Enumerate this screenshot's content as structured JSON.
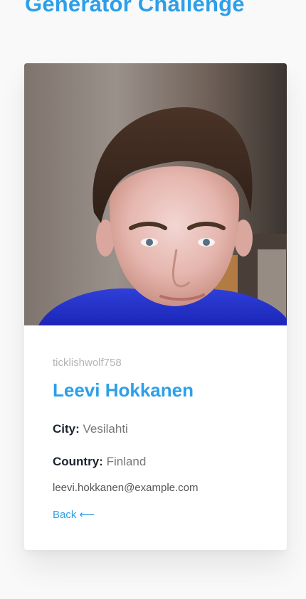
{
  "page": {
    "heading": "Generator Challenge"
  },
  "profile": {
    "username": "ticklishwolf758",
    "name": "Leevi Hokkanen",
    "city_label": "City:",
    "city": "Vesilahti",
    "country_label": "Country:",
    "country": "Finland",
    "email": "leevi.hokkanen@example.com",
    "back_label": "Back ⟵"
  },
  "colors": {
    "accent": "#2d9fe8",
    "label": "#1c2330",
    "muted": "#b4b4b4",
    "background": "#f9f9fa"
  }
}
